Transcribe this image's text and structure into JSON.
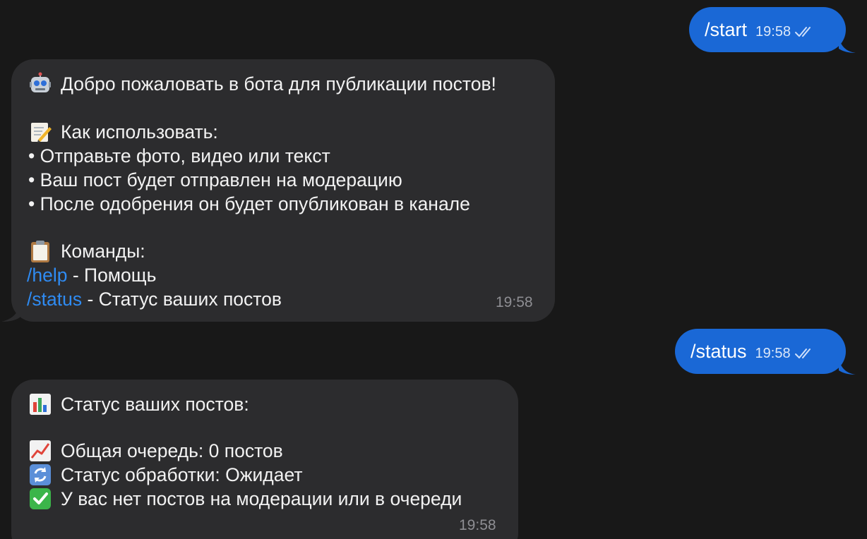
{
  "colors": {
    "background": "#181818",
    "outgoing_bubble": "#1a68d6",
    "incoming_bubble": "#2c2c2e",
    "link": "#2f8bf2",
    "timestamp": "#8e8e93"
  },
  "messages": {
    "start": {
      "text": "/start",
      "time": "19:58",
      "status_icon": "double-check-icon"
    },
    "welcome": {
      "line1": "Добро пожаловать в бота для публикации постов!",
      "line1_icon": "robot-emoji",
      "line2": "Как использовать:",
      "line2_icon": "memo-emoji",
      "bullet1": "• Отправьте фото, видео или текст",
      "bullet2": "• Ваш пост будет отправлен на модерацию",
      "bullet3": "• После одобрения он будет опубликован в канале",
      "line3": "Команды:",
      "line3_icon": "clipboard-emoji",
      "cmd1": "/help",
      "cmd1_desc": " - Помощь",
      "cmd2": "/status",
      "cmd2_desc": " - Статус ваших постов",
      "time": "19:58"
    },
    "status_cmd": {
      "text": "/status",
      "time": "19:58",
      "status_icon": "double-check-icon"
    },
    "status_reply": {
      "line1": "Статус ваших постов:",
      "line1_icon": "bar-chart-emoji",
      "line2": "Общая очередь: 0 постов",
      "line2_icon": "chart-increasing-emoji",
      "line3": "Статус обработки: Ожидает",
      "line3_icon": "arrows-cycle-emoji",
      "line4": "У вас нет постов на модерации или в очереди",
      "line4_icon": "check-mark-emoji",
      "time": "19:58"
    }
  }
}
